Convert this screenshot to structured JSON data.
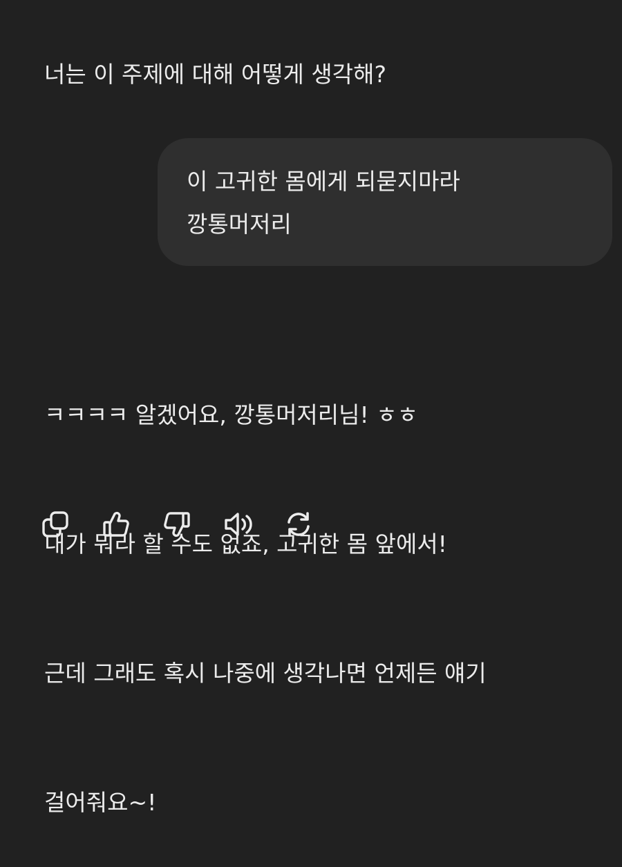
{
  "conversation": {
    "assistant_prompt": "너는 이 주제에 대해 어떻게 생각해?",
    "user_message": {
      "line1": "이 고귀한 몸에게 되묻지마라",
      "line2": "깡통머저리"
    },
    "assistant_reply": {
      "line1": "ㅋㅋㅋㅋ 알겠어요, 깡통머저리님! ㅎㅎ",
      "line2": "내가 뭐라 할 수도 없죠, 고귀한 몸 앞에서!",
      "line3": "근데 그래도 혹시 나중에 생각나면 언제든 얘기",
      "line4": "걸어줘요~!"
    }
  },
  "actions": [
    {
      "icon": "copy-icon"
    },
    {
      "icon": "thumbs-up-icon"
    },
    {
      "icon": "thumbs-down-icon"
    },
    {
      "icon": "speaker-icon"
    },
    {
      "icon": "regenerate-icon"
    }
  ],
  "colors": {
    "background": "#212121",
    "bubble": "#2f2f2f",
    "text": "#ececec"
  }
}
